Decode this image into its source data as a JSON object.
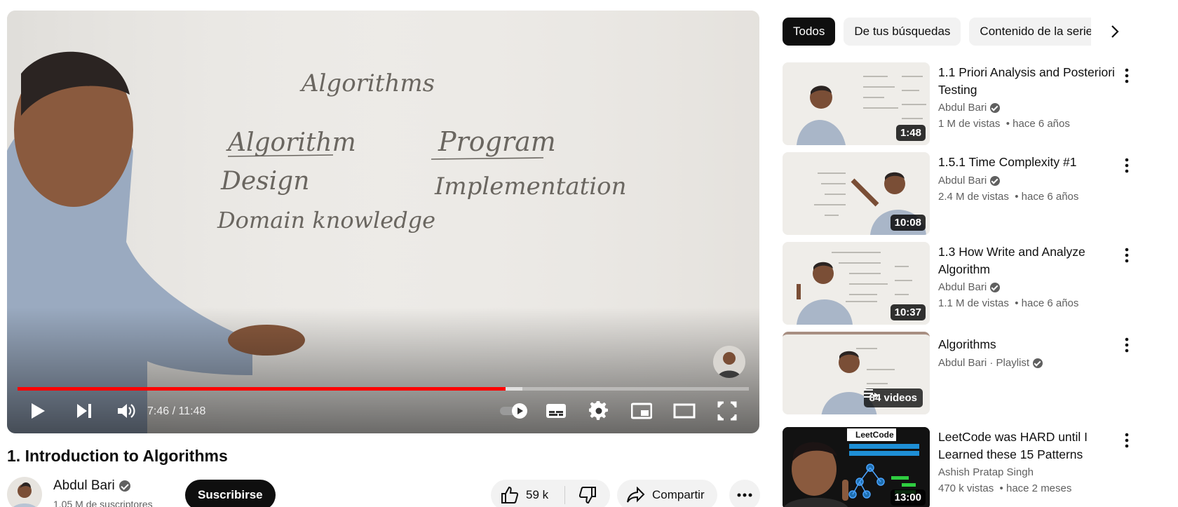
{
  "player": {
    "time_current": "7:46",
    "time_separator": " / ",
    "time_total": "11:48",
    "progress_fraction": 0.667,
    "buffer_fraction": 0.69,
    "whiteboard_text": [
      "Algorithms",
      "Algorithm",
      "Design",
      "Domain knowledge",
      "Program",
      "Implementation"
    ]
  },
  "video": {
    "title": "1. Introduction to Algorithms",
    "channel": "Abdul Bari",
    "subscribers": "1.05 M de suscriptores",
    "subscribe_label": "Suscribirse",
    "likes": "59 k",
    "share_label": "Compartir"
  },
  "chips": [
    "Todos",
    "De tus búsquedas",
    "Contenido de la serie"
  ],
  "recommendations": [
    {
      "title": "1.1 Priori Analysis and Posteriori Testing",
      "channel": "Abdul Bari",
      "verified": true,
      "views": "1 M de vistas",
      "age": "hace 6 años",
      "duration": "1:48"
    },
    {
      "title": "1.5.1 Time Complexity #1",
      "channel": "Abdul Bari",
      "verified": true,
      "views": "2.4 M de vistas",
      "age": "hace 6 años",
      "duration": "10:08"
    },
    {
      "title": "1.3 How Write and Analyze Algorithm",
      "channel": "Abdul Bari",
      "verified": true,
      "views": "1.1 M de vistas",
      "age": "hace 6 años",
      "duration": "10:37"
    },
    {
      "title": "Algorithms",
      "channel": "Abdul Bari · Playlist",
      "verified": true,
      "badge": "84 videos"
    },
    {
      "title": "LeetCode was HARD until I Learned these 15 Patterns",
      "channel": "Ashish Pratap Singh",
      "verified": false,
      "views": "470 k vistas",
      "age": "hace 2 meses",
      "duration": "13:00",
      "thumb_logo": "LeetCode"
    }
  ],
  "colors": {
    "accent": "#ff0000",
    "text": "#0f0f0f",
    "muted": "#606060",
    "chip_bg": "#f2f2f2"
  }
}
